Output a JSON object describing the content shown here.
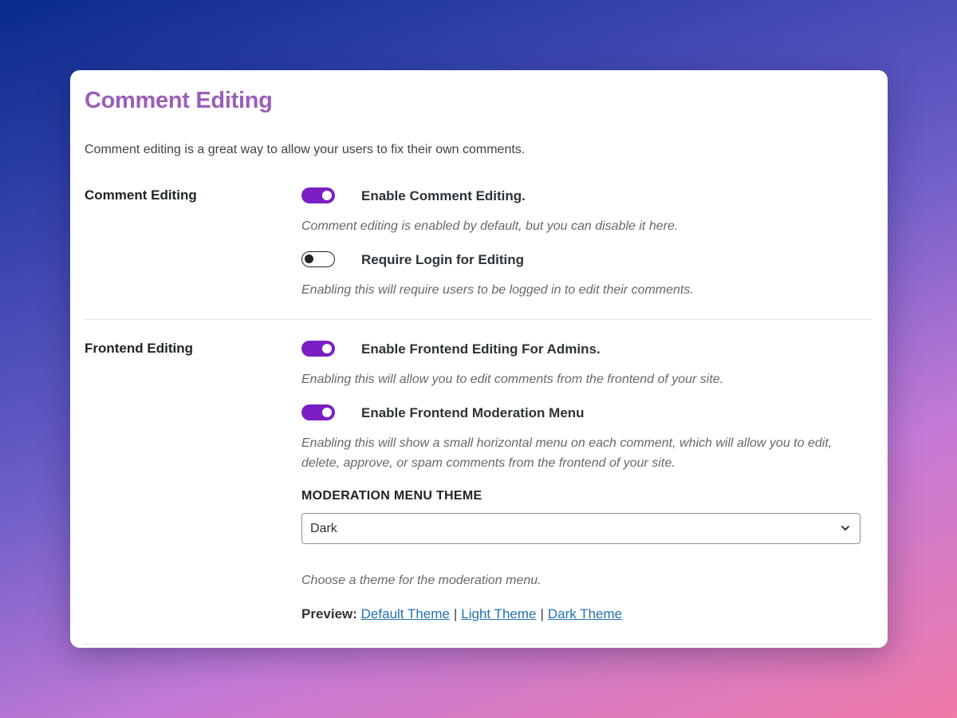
{
  "page": {
    "title": "Comment Editing",
    "intro": "Comment editing is a great way to allow your users to fix their own comments."
  },
  "colors": {
    "accent": "#7b1fc4",
    "title": "#9b5fb7",
    "link": "#2271b1"
  },
  "sections": {
    "comment_editing": {
      "label": "Comment Editing",
      "options": [
        {
          "label": "Enable Comment Editing.",
          "enabled": true,
          "description": "Comment editing is enabled by default, but you can disable it here."
        },
        {
          "label": "Require Login for Editing",
          "enabled": false,
          "description": "Enabling this will require users to be logged in to edit their comments."
        }
      ]
    },
    "frontend_editing": {
      "label": "Frontend Editing",
      "options": [
        {
          "label": "Enable Frontend Editing For Admins.",
          "enabled": true,
          "description": "Enabling this will allow you to edit comments from the frontend of your site."
        },
        {
          "label": "Enable Frontend Moderation Menu",
          "enabled": true,
          "description": "Enabling this will show a small horizontal menu on each comment, which will allow you to edit, delete, approve, or spam comments from the frontend of your site."
        }
      ],
      "theme_heading": "MODERATION MENU THEME",
      "theme_value": "Dark",
      "theme_description": "Choose a theme for the moderation menu.",
      "preview_label": "Preview:",
      "preview_links": [
        "Default Theme",
        "Light Theme",
        "Dark Theme"
      ],
      "preview_separator": "|"
    }
  }
}
